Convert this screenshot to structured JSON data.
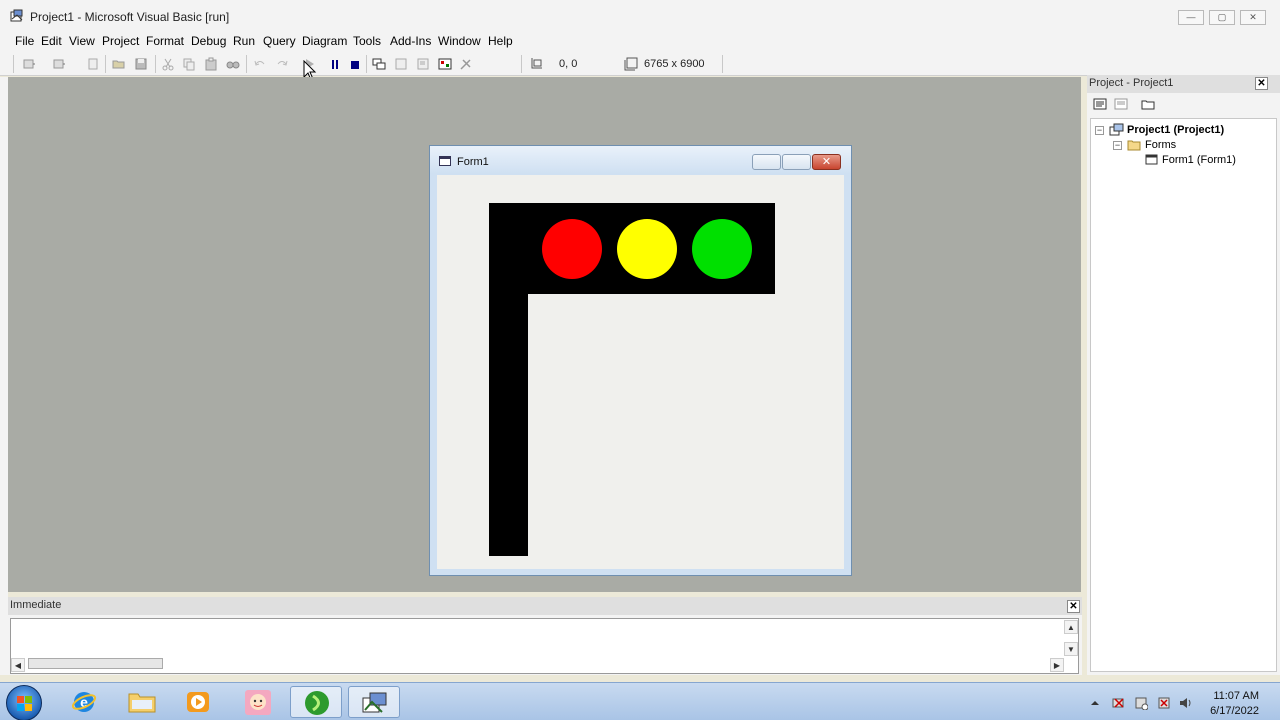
{
  "window": {
    "title": "Project1 - Microsoft Visual Basic [run]",
    "minimize_symbol": "—",
    "maximize_symbol": "▢",
    "close_symbol": "✕"
  },
  "menu": [
    "File",
    "Edit",
    "View",
    "Project",
    "Format",
    "Debug",
    "Run",
    "Query",
    "Diagram",
    "Tools",
    "Add-Ins",
    "Window",
    "Help"
  ],
  "toolbar": {
    "position": "0, 0",
    "size": "6765 x 6900",
    "buttons": [
      "add-project",
      "add-form",
      "menu-editor",
      "open-project",
      "save-project",
      "cut",
      "copy",
      "paste",
      "find",
      "undo",
      "redo",
      "start",
      "break",
      "end",
      "project-explorer",
      "properties-window",
      "form-layout",
      "object-browser",
      "toolbox"
    ]
  },
  "running_form": {
    "title": "Form1",
    "lights": [
      {
        "name": "red",
        "color": "#ff0000"
      },
      {
        "name": "yellow",
        "color": "#ffff00"
      },
      {
        "name": "green",
        "color": "#00e000"
      }
    ]
  },
  "project_explorer": {
    "title": "Project - Project1",
    "tree": {
      "project": "Project1 (Project1)",
      "folder": "Forms",
      "form": "Form1 (Form1)"
    }
  },
  "immediate": {
    "title": "Immediate",
    "content": ""
  },
  "taskbar": {
    "apps": [
      "internet-explorer",
      "file-explorer",
      "media-player",
      "paint-app",
      "green-app",
      "visual-basic"
    ],
    "time": "11:07 AM",
    "date": "6/17/2022"
  },
  "colors": {
    "workspace": "#a9aba5",
    "form_background": "#f0f0ed",
    "shape": "#000000"
  }
}
